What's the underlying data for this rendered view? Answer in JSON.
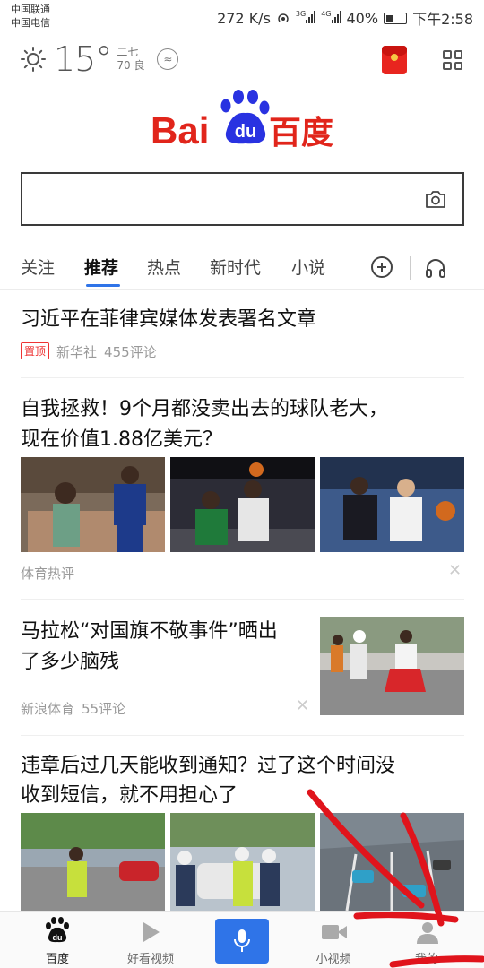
{
  "status_bar": {
    "carrier_1": "中国联通",
    "carrier_2": "中国电信",
    "speed": "272 K/s",
    "net_1": "3G",
    "net_2": "4G",
    "battery": "40%",
    "time": "下午2:58"
  },
  "weather": {
    "temp": "15°",
    "lunar": "二七",
    "aqi": "70 良",
    "aqi_icon": "≈",
    "icon": "sun-icon"
  },
  "logo": {
    "text_left": "Bai",
    "paw_text": "du",
    "text_right": "百度"
  },
  "search": {
    "value": "",
    "placeholder": ""
  },
  "tabs": {
    "items": [
      "关注",
      "推荐",
      "热点",
      "新时代",
      "小说"
    ],
    "active": "推荐"
  },
  "feed": [
    {
      "title": "习近平在菲律宾媒体发表署名文章",
      "pin": "置顶",
      "source": "新华社",
      "comments": "455评论"
    },
    {
      "title_line1": "自我拯救！9个月都没卖出去的球队老大，",
      "title_line2": "现在价值1.88亿美元？",
      "source": "体育热评"
    },
    {
      "title_line1": "马拉松“对国旗不敬事件”晒出",
      "title_line2": "了多少脑残",
      "source": "新浪体育",
      "comments": "55评论"
    },
    {
      "title_line1": "违章后过几天能收到通知？过了这个时间没",
      "title_line2": "收到短信，就不用担心了"
    }
  ],
  "bottom_nav": {
    "home": "百度",
    "videos": "好看视频",
    "short_video": "小视频",
    "mine": "我的",
    "home_icon_text": "du"
  },
  "colors": {
    "accent": "#2f74e8",
    "brand_red": "#e1251b",
    "brand_blue": "#2932e1",
    "annotation": "#e0141c"
  }
}
